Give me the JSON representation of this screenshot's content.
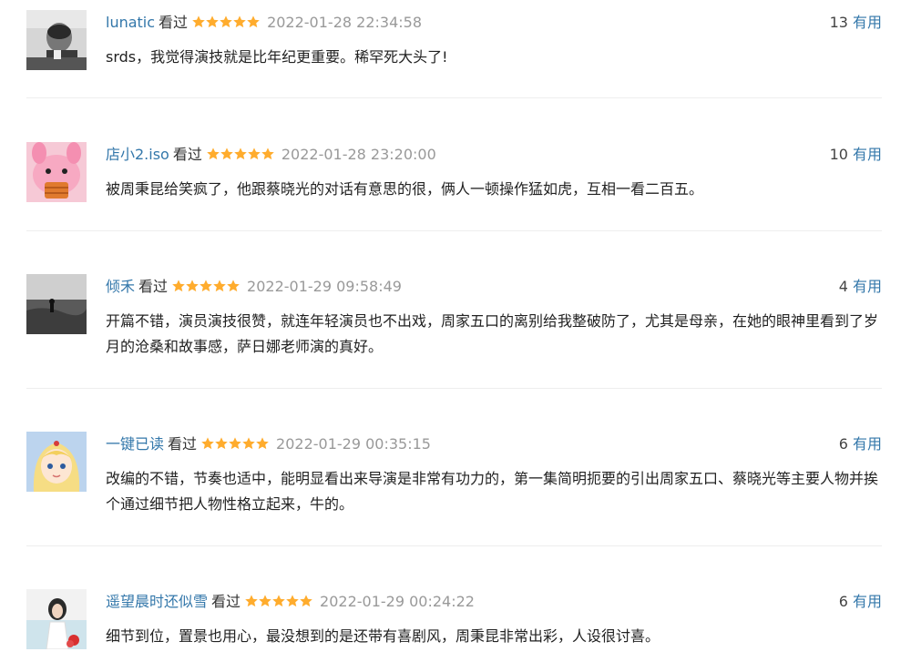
{
  "comments": [
    {
      "user": "lunatic",
      "status": "看过",
      "rating": 5,
      "time": "2022-01-28 22:34:58",
      "votes": "13",
      "useful_label": "有用",
      "content": "srds，我觉得演技就是比年纪更重要。稀罕死大头了!"
    },
    {
      "user": "店小2.iso",
      "status": "看过",
      "rating": 5,
      "time": "2022-01-28 23:20:00",
      "votes": "10",
      "useful_label": "有用",
      "content": "被周秉昆给笑疯了，他跟蔡晓光的对话有意思的很，俩人一顿操作猛如虎，互相一看二百五。"
    },
    {
      "user": "倾禾",
      "status": "看过",
      "rating": 5,
      "time": "2022-01-29 09:58:49",
      "votes": "4",
      "useful_label": "有用",
      "content": "开篇不错，演员演技很赞，就连年轻演员也不出戏，周家五口的离别给我整破防了，尤其是母亲，在她的眼神里看到了岁月的沧桑和故事感，萨日娜老师演的真好。"
    },
    {
      "user": "一键已读",
      "status": "看过",
      "rating": 5,
      "time": "2022-01-29 00:35:15",
      "votes": "6",
      "useful_label": "有用",
      "content": "改编的不错，节奏也适中，能明显看出来导演是非常有功力的，第一集简明扼要的引出周家五口、蔡晓光等主要人物并挨个通过细节把人物性格立起来，牛的。"
    },
    {
      "user": "遥望晨时还似雪",
      "status": "看过",
      "rating": 5,
      "time": "2022-01-29 00:24:22",
      "votes": "6",
      "useful_label": "有用",
      "content": "细节到位，置景也用心，最没想到的是还带有喜剧风，周秉昆非常出彩，人设很讨喜。"
    }
  ],
  "colors": {
    "link": "#3377aa",
    "star": "#ffac2d",
    "time": "#999999",
    "divider": "#eeeeee"
  },
  "icons": {
    "star": "star-icon"
  }
}
